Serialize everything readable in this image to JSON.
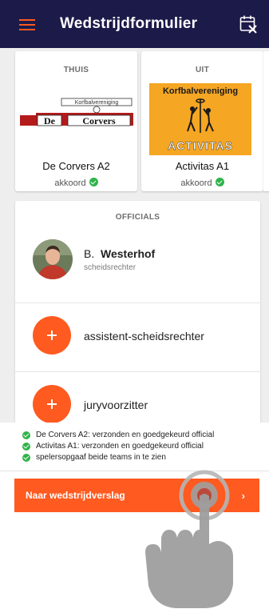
{
  "appbar": {
    "title": "Wedstrijdformulier",
    "menu_icon": "hamburger-menu-icon",
    "action_icon": "calendar-cross-icon",
    "accent": "#ff5a1f",
    "background": "#1c1a49"
  },
  "teams": {
    "home": {
      "side_label": "THUIS",
      "name": "De Corvers A2",
      "status": "akkoord",
      "logo": {
        "top_text": "Korfbalvereniging",
        "main_left": "De",
        "main_right": "Corvers"
      }
    },
    "away": {
      "side_label": "UIT",
      "name": "Activitas A1",
      "status": "akkoord",
      "logo": {
        "top_text": "Korfbalvereniging",
        "bottom_text": "ACTIVITAS"
      }
    }
  },
  "officials": {
    "heading": "OFFICIALS",
    "referee": {
      "initial": "B.",
      "surname": "Westerhof",
      "role": "scheidsrechter"
    },
    "add_assistant_label": "assistent-scheidsrechter",
    "add_jury_label": "juryvoorzitter"
  },
  "checklist": [
    "De Corvers A2: verzonden en goedgekeurd official",
    "Activitas A1: verzonden en goedgekeurd official",
    "spelersopgaaf beide teams in te zien"
  ],
  "cta": {
    "label": "Naar wedstrijdverslag",
    "chevron": "›"
  },
  "colors": {
    "status_green": "#2fb34a",
    "background_grey": "#eeeeee"
  }
}
